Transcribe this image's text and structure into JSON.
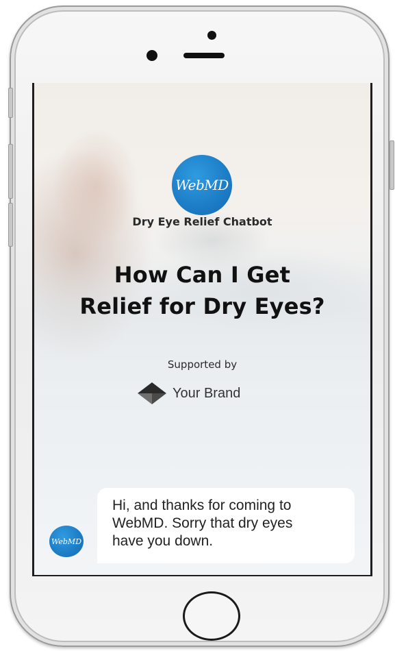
{
  "header": {
    "logo_text": "WebMD",
    "chatbot_name": "Dry Eye Relief Chatbot"
  },
  "hero": {
    "headline_line1": "How Can I Get",
    "headline_line2": "Relief for Dry Eyes?"
  },
  "sponsor": {
    "supported_by": "Supported by",
    "brand_name": "Your Brand",
    "brand_icon": "diamond-logo-icon"
  },
  "chat": {
    "avatar_text": "WebMD",
    "message_line1": "Hi, and thanks for coming to",
    "message_line2": "WebMD. Sorry that dry eyes",
    "message_line3": "have you down."
  },
  "colors": {
    "brand_blue": "#1c7cc6",
    "headline": "#111111",
    "bubble_bg": "#ffffff"
  }
}
